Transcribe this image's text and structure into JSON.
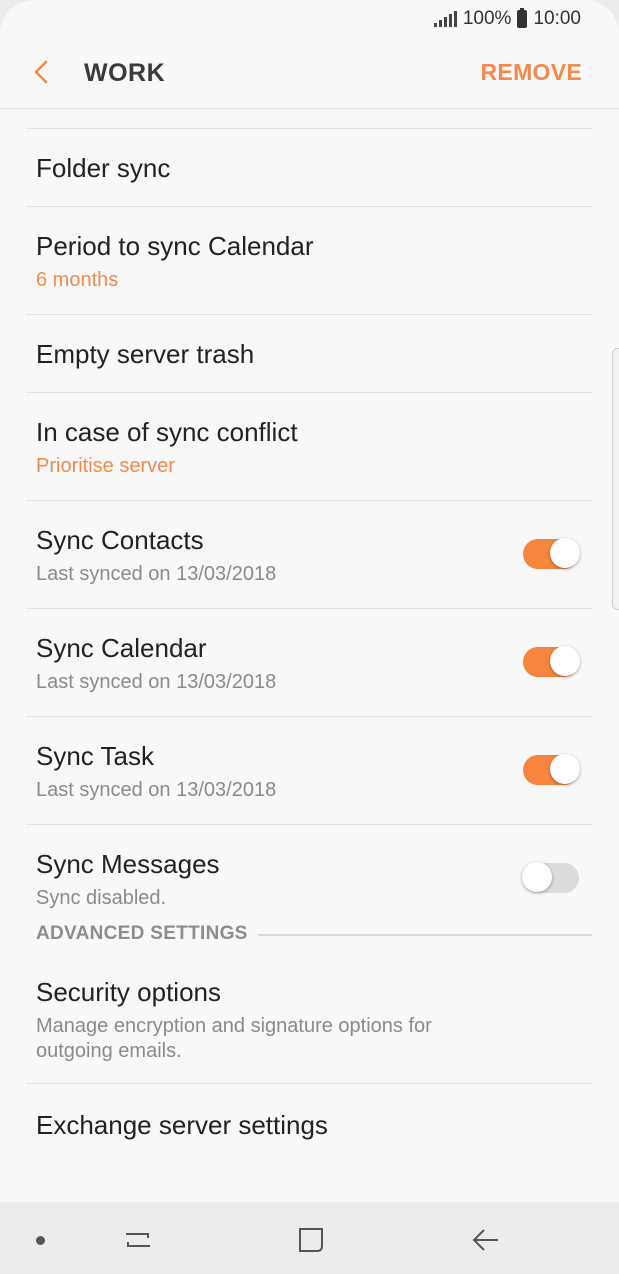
{
  "status_bar": {
    "battery_percent": "100%",
    "time": "10:00"
  },
  "app_bar": {
    "back_icon": "back-chevron-icon",
    "title": "WORK",
    "action": "REMOVE"
  },
  "colors": {
    "accent": "#f28a4e",
    "toggle_on": "#f7853e",
    "toggle_off": "#dcdcdc"
  },
  "settings": {
    "folder_sync": {
      "title": "Folder sync"
    },
    "period_calendar": {
      "title": "Period to sync Calendar",
      "value": "6 months"
    },
    "empty_trash": {
      "title": "Empty server trash"
    },
    "sync_conflict": {
      "title": "In case of sync conflict",
      "value": "Prioritise server"
    },
    "sync_contacts": {
      "title": "Sync Contacts",
      "subtitle": "Last synced on 13/03/2018",
      "enabled": true
    },
    "sync_calendar": {
      "title": "Sync Calendar",
      "subtitle": "Last synced on 13/03/2018",
      "enabled": true
    },
    "sync_task": {
      "title": "Sync Task",
      "subtitle": "Last synced on 13/03/2018",
      "enabled": true
    },
    "sync_messages": {
      "title": "Sync Messages",
      "subtitle": "Sync disabled.",
      "enabled": false
    }
  },
  "advanced": {
    "header": "ADVANCED SETTINGS",
    "security": {
      "title": "Security options",
      "subtitle": "Manage encryption and signature options for outgoing emails."
    },
    "exchange": {
      "title": "Exchange server settings"
    }
  },
  "nav_bar": {
    "icons": [
      "recent-apps-icon",
      "home-icon",
      "back-icon"
    ]
  }
}
